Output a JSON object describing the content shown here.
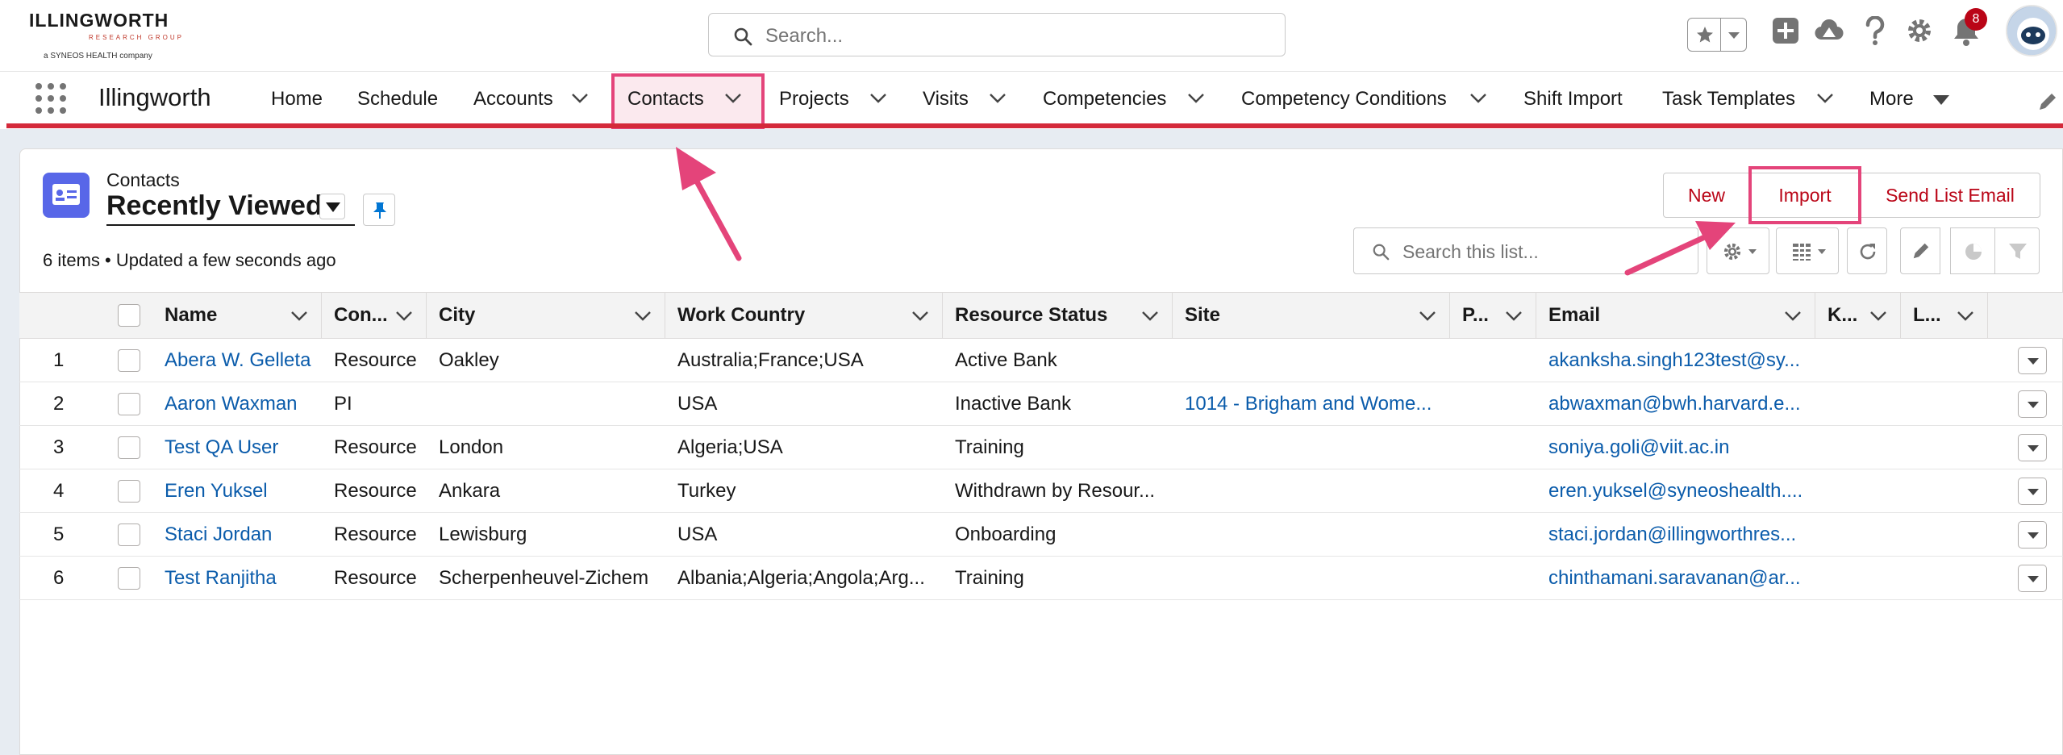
{
  "header": {
    "logo_main": "ILLINGWORTH",
    "logo_sub": "RESEARCH GROUP",
    "logo_tag": "a SYNEOS HEALTH company",
    "search_placeholder": "Search...",
    "notification_count": "8"
  },
  "nav": {
    "app_name": "Illingworth",
    "items": [
      {
        "label": "Home",
        "has_menu": false
      },
      {
        "label": "Schedule",
        "has_menu": false
      },
      {
        "label": "Accounts",
        "has_menu": true
      },
      {
        "label": "Contacts",
        "has_menu": true,
        "selected": true
      },
      {
        "label": "Projects",
        "has_menu": true
      },
      {
        "label": "Visits",
        "has_menu": true
      },
      {
        "label": "Competencies",
        "has_menu": true
      },
      {
        "label": "Competency Conditions",
        "has_menu": true
      },
      {
        "label": "Shift Import",
        "has_menu": false
      },
      {
        "label": "Task Templates",
        "has_menu": true
      },
      {
        "label": "More",
        "has_menu": true
      }
    ]
  },
  "list": {
    "object_label": "Contacts",
    "view_name": "Recently Viewed",
    "meta": "6 items • Updated a few seconds ago",
    "buttons": {
      "new": "New",
      "import": "Import",
      "send_email": "Send List Email"
    },
    "search_placeholder": "Search this list...",
    "columns": [
      "Name",
      "Con...",
      "City",
      "Work Country",
      "Resource Status",
      "Site",
      "P...",
      "Email",
      "K...",
      "L..."
    ],
    "rows": [
      {
        "num": "1",
        "name": "Abera W. Gelleta",
        "type": "Resource",
        "city": "Oakley",
        "country": "Australia;France;USA",
        "status": "Active Bank",
        "site": "",
        "email": "akanksha.singh123test@sy..."
      },
      {
        "num": "2",
        "name": "Aaron Waxman",
        "type": "PI",
        "city": "",
        "country": "USA",
        "status": "Inactive Bank",
        "site": "1014 - Brigham and Wome...",
        "email": "abwaxman@bwh.harvard.e..."
      },
      {
        "num": "3",
        "name": "Test QA User",
        "type": "Resource",
        "city": "London",
        "country": "Algeria;USA",
        "status": "Training",
        "site": "",
        "email": "soniya.goli@viit.ac.in"
      },
      {
        "num": "4",
        "name": "Eren Yuksel",
        "type": "Resource",
        "city": "Ankara",
        "country": "Turkey",
        "status": "Withdrawn by Resour...",
        "site": "",
        "email": "eren.yuksel@syneoshealth...."
      },
      {
        "num": "5",
        "name": "Staci Jordan",
        "type": "Resource",
        "city": "Lewisburg",
        "country": "USA",
        "status": "Onboarding",
        "site": "",
        "email": "staci.jordan@illingworthres..."
      },
      {
        "num": "6",
        "name": "Test Ranjitha",
        "type": "Resource",
        "city": "Scherpenheuvel-Zichem",
        "country": "Albania;Algeria;Angola;Arg...",
        "status": "Training",
        "site": "",
        "email": "chinthamani.saravanan@ar..."
      }
    ]
  },
  "colors": {
    "brand_red": "#d4293a",
    "link": "#0b5cab",
    "highlight": "#e4447a",
    "object_icon": "#5867e8"
  }
}
